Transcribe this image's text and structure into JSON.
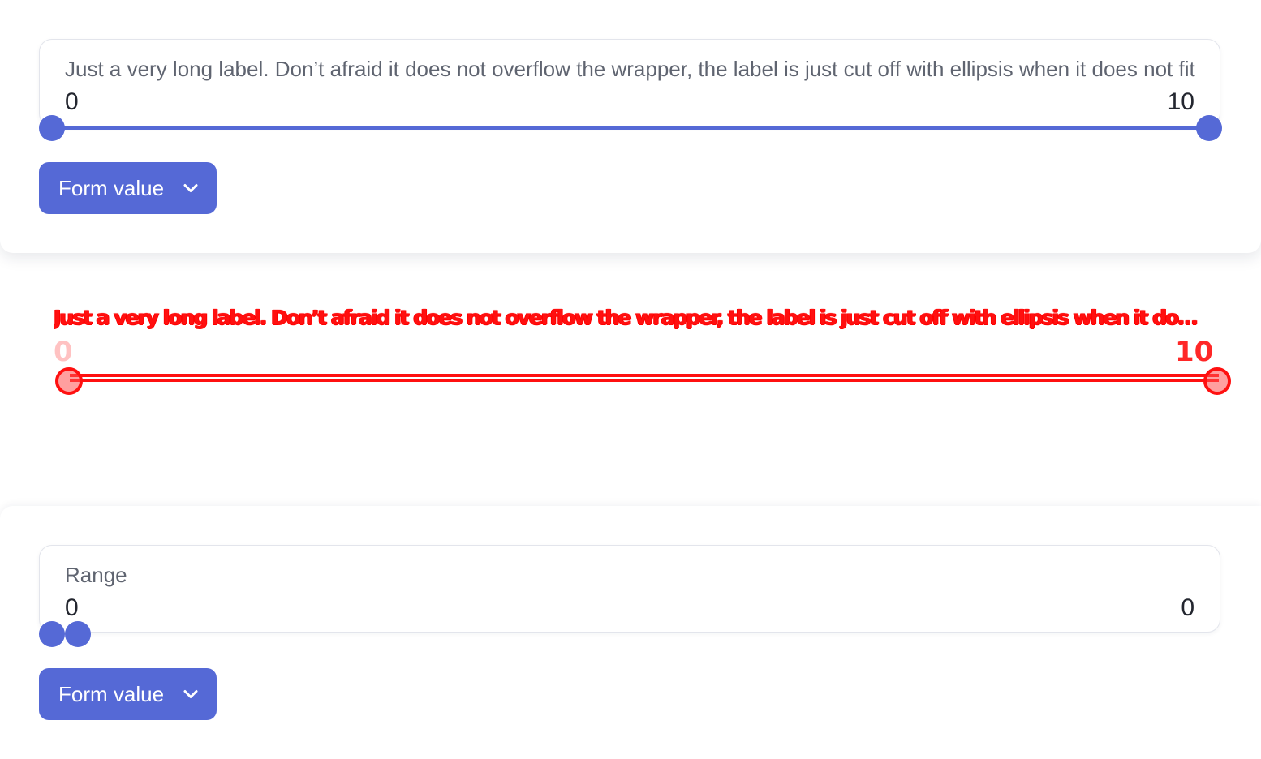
{
  "colors": {
    "accent": "#5569d6",
    "label": "#5f6470",
    "value": "#23262f",
    "overlay": "#ff1010"
  },
  "top_field": {
    "label": "Just a very long label. Don’t afraid it does not overflow the wrapper, the label is just cut off with ellipsis when it does not fit",
    "min_value": "0",
    "max_value": "10",
    "selected_fraction": [
      0,
      1
    ]
  },
  "top_form_button": {
    "label": "Form value",
    "icon": "chevron-down-icon"
  },
  "overlay": {
    "label": "Just a very long label. Don’t afraid it does not overflow the wrapper, the label is just cut off with ellipsis when it does not fit",
    "min_value": "0",
    "max_value": "10"
  },
  "bottom_field": {
    "label": "Range",
    "min_value": "0",
    "max_value": "0",
    "selected_fraction": [
      0,
      0
    ]
  },
  "bottom_form_button": {
    "label": "Form value",
    "icon": "chevron-down-icon"
  }
}
